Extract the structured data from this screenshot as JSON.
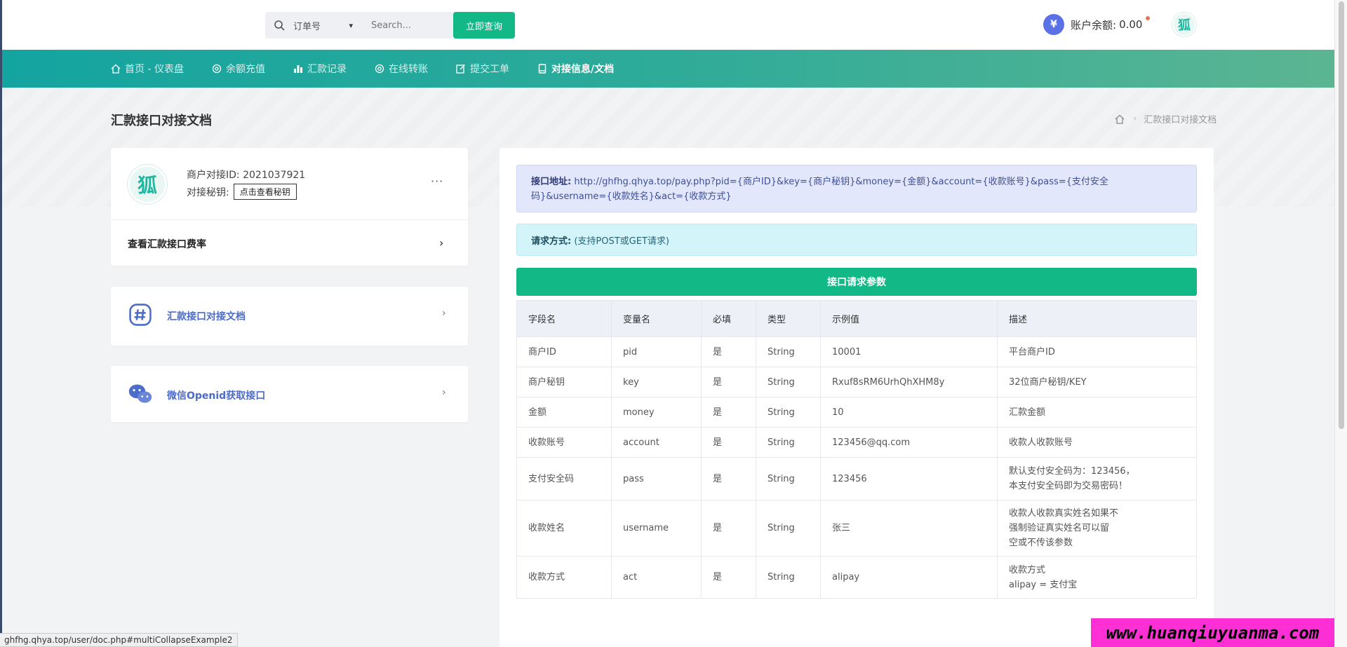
{
  "search": {
    "type_selected": "订单号",
    "placeholder": "Search...",
    "button_label": "立即查询"
  },
  "balance": {
    "symbol": "¥",
    "label": "账户余额:",
    "value": "0.00"
  },
  "avatar_text": "狐",
  "nav": {
    "items": [
      {
        "label": "首页 - 仪表盘",
        "icon": "home-icon"
      },
      {
        "label": "余额充值",
        "icon": "target-icon"
      },
      {
        "label": "汇款记录",
        "icon": "bar-chart-icon"
      },
      {
        "label": "在线转账",
        "icon": "lifebuoy-icon"
      },
      {
        "label": "提交工单",
        "icon": "edit-icon"
      },
      {
        "label": "对接信息/文档",
        "icon": "book-icon"
      }
    ]
  },
  "page": {
    "title": "汇款接口对接文档",
    "breadcrumb_current": "汇款接口对接文档"
  },
  "profile": {
    "merchant_id_label": "商户对接ID:",
    "merchant_id": "2021037921",
    "key_label": "对接秘钥:",
    "key_button": "点击查看秘钥",
    "more": "···",
    "rate_link": "查看汇款接口费率",
    "rate_arrow": "›"
  },
  "menu": {
    "doc_label": "汇款接口对接文档",
    "wx_label": "微信Openid获取接口",
    "arrow": "›"
  },
  "api": {
    "url_label": "接口地址:",
    "url": "http://ghfhg.qhya.top/pay.php?pid={商户ID}&key={商户秘钥}&money={金额}&account={收款账号}&pass={支付安全码}&username={收款姓名}&act={收款方式}",
    "method_label": "请求方式:",
    "method": "(支持POST或GET请求)",
    "params_title": "接口请求参数"
  },
  "table": {
    "headers": [
      "字段名",
      "变量名",
      "必填",
      "类型",
      "示例值",
      "描述"
    ],
    "rows": [
      [
        "商户ID",
        "pid",
        "是",
        "String",
        "10001",
        "平台商户ID"
      ],
      [
        "商户秘钥",
        "key",
        "是",
        "String",
        "Rxuf8sRM6UrhQhXHM8y",
        "32位商户秘钥/KEY"
      ],
      [
        "金额",
        "money",
        "是",
        "String",
        "10",
        "汇款金额"
      ],
      [
        "收款账号",
        "account",
        "是",
        "String",
        "123456@qq.com",
        "收款人收款账号"
      ],
      [
        "支付安全码",
        "pass",
        "是",
        "String",
        "123456",
        "默认支付安全码为：123456，\n本支付安全码即为交易密码！"
      ],
      [
        "收款姓名",
        "username",
        "是",
        "String",
        "张三",
        "收款人收款真实姓名如果不\n强制验证真实姓名可以留\n空或不传该参数"
      ],
      [
        "收款方式",
        "act",
        "是",
        "String",
        "alipay",
        "收款方式\nalipay = 支付宝"
      ]
    ]
  },
  "status_url": "ghfhg.qhya.top/user/doc.php#multiCollapseExample2",
  "watermark": "www.huanqiuyuanma.com",
  "colors": {
    "accent": "#12b886",
    "nav_start": "#14a4a0",
    "nav_end": "#5bb592",
    "link": "#4b6cc9"
  }
}
